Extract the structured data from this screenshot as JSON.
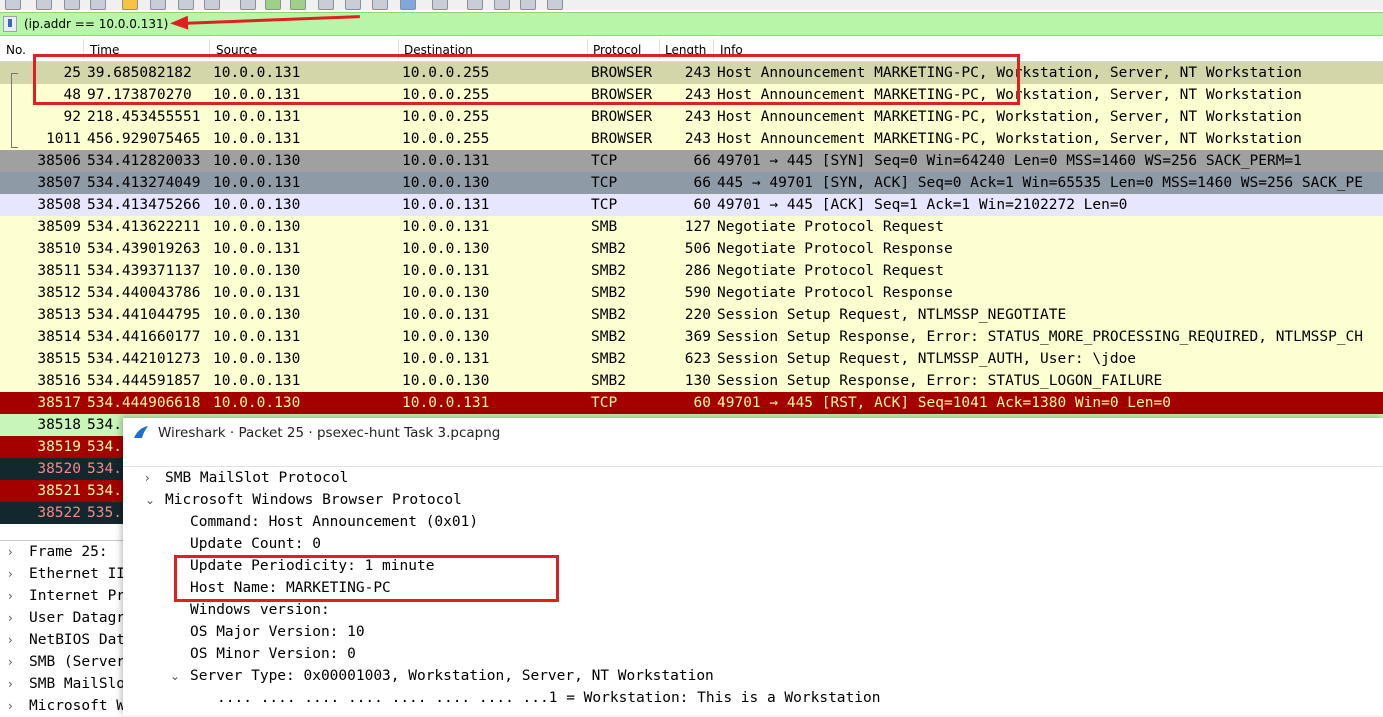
{
  "filter": {
    "expression": "(ip.addr == 10.0.0.131)"
  },
  "columns": [
    "No.",
    "Time",
    "Source",
    "Destination",
    "Protocol",
    "Length",
    "Info"
  ],
  "packets": [
    {
      "no": "25",
      "time": "39.685082182",
      "src": "10.0.0.131",
      "dst": "10.0.0.255",
      "proto": "BROWSER",
      "len": "243",
      "info": "Host Announcement MARKETING-PC, Workstation, Server, NT Workstation",
      "bg": "#d2d6a8",
      "fg": "#000000"
    },
    {
      "no": "48",
      "time": "97.173870270",
      "src": "10.0.0.131",
      "dst": "10.0.0.255",
      "proto": "BROWSER",
      "len": "243",
      "info": "Host Announcement MARKETING-PC, Workstation, Server, NT Workstation",
      "bg": "#feffd0",
      "fg": "#000000"
    },
    {
      "no": "92",
      "time": "218.453455551",
      "src": "10.0.0.131",
      "dst": "10.0.0.255",
      "proto": "BROWSER",
      "len": "243",
      "info": "Host Announcement MARKETING-PC, Workstation, Server, NT Workstation",
      "bg": "#feffd0",
      "fg": "#000000"
    },
    {
      "no": "1011",
      "time": "456.929075465",
      "src": "10.0.0.131",
      "dst": "10.0.0.255",
      "proto": "BROWSER",
      "len": "243",
      "info": "Host Announcement MARKETING-PC, Workstation, Server, NT Workstation",
      "bg": "#feffd0",
      "fg": "#000000"
    },
    {
      "no": "38506",
      "time": "534.412820033",
      "src": "10.0.0.130",
      "dst": "10.0.0.131",
      "proto": "TCP",
      "len": "66",
      "info": "49701 → 445 [SYN] Seq=0 Win=64240 Len=0 MSS=1460 WS=256 SACK_PERM=1",
      "bg": "#a0a0a0",
      "fg": "#000000"
    },
    {
      "no": "38507",
      "time": "534.413274049",
      "src": "10.0.0.131",
      "dst": "10.0.0.130",
      "proto": "TCP",
      "len": "66",
      "info": "445 → 49701 [SYN, ACK] Seq=0 Ack=1 Win=65535 Len=0 MSS=1460 WS=256 SACK_PE",
      "bg": "#8e9aa6",
      "fg": "#000000"
    },
    {
      "no": "38508",
      "time": "534.413475266",
      "src": "10.0.0.130",
      "dst": "10.0.0.131",
      "proto": "TCP",
      "len": "60",
      "info": "49701 → 445 [ACK] Seq=1 Ack=1 Win=2102272 Len=0",
      "bg": "#e7e6ff",
      "fg": "#000000"
    },
    {
      "no": "38509",
      "time": "534.413622211",
      "src": "10.0.0.130",
      "dst": "10.0.0.131",
      "proto": "SMB",
      "len": "127",
      "info": "Negotiate Protocol Request",
      "bg": "#feffd0",
      "fg": "#000000"
    },
    {
      "no": "38510",
      "time": "534.439019263",
      "src": "10.0.0.131",
      "dst": "10.0.0.130",
      "proto": "SMB2",
      "len": "506",
      "info": "Negotiate Protocol Response",
      "bg": "#feffd0",
      "fg": "#000000"
    },
    {
      "no": "38511",
      "time": "534.439371137",
      "src": "10.0.0.130",
      "dst": "10.0.0.131",
      "proto": "SMB2",
      "len": "286",
      "info": "Negotiate Protocol Request",
      "bg": "#feffd0",
      "fg": "#000000"
    },
    {
      "no": "38512",
      "time": "534.440043786",
      "src": "10.0.0.131",
      "dst": "10.0.0.130",
      "proto": "SMB2",
      "len": "590",
      "info": "Negotiate Protocol Response",
      "bg": "#feffd0",
      "fg": "#000000"
    },
    {
      "no": "38513",
      "time": "534.441044795",
      "src": "10.0.0.130",
      "dst": "10.0.0.131",
      "proto": "SMB2",
      "len": "220",
      "info": "Session Setup Request, NTLMSSP_NEGOTIATE",
      "bg": "#feffd0",
      "fg": "#000000"
    },
    {
      "no": "38514",
      "time": "534.441660177",
      "src": "10.0.0.131",
      "dst": "10.0.0.130",
      "proto": "SMB2",
      "len": "369",
      "info": "Session Setup Response, Error: STATUS_MORE_PROCESSING_REQUIRED, NTLMSSP_CH",
      "bg": "#feffd0",
      "fg": "#000000"
    },
    {
      "no": "38515",
      "time": "534.442101273",
      "src": "10.0.0.130",
      "dst": "10.0.0.131",
      "proto": "SMB2",
      "len": "623",
      "info": "Session Setup Request, NTLMSSP_AUTH, User: \\jdoe",
      "bg": "#feffd0",
      "fg": "#000000"
    },
    {
      "no": "38516",
      "time": "534.444591857",
      "src": "10.0.0.131",
      "dst": "10.0.0.130",
      "proto": "SMB2",
      "len": "130",
      "info": "Session Setup Response, Error: STATUS_LOGON_FAILURE",
      "bg": "#feffd0",
      "fg": "#000000"
    },
    {
      "no": "38517",
      "time": "534.444906618",
      "src": "10.0.0.130",
      "dst": "10.0.0.131",
      "proto": "TCP",
      "len": "60",
      "info": "49701 → 445 [RST, ACK] Seq=1041 Ack=1380 Win=0 Len=0",
      "bg": "#a40000",
      "fg": "#fffc9c"
    },
    {
      "no": "38518",
      "time": "534.",
      "src": "",
      "dst": "",
      "proto": "",
      "len": "",
      "info": "",
      "bg": "#c8f5b8",
      "fg": "#000000"
    },
    {
      "no": "38519",
      "time": "534.",
      "src": "",
      "dst": "",
      "proto": "",
      "len": "",
      "info": "",
      "bg": "#a40000",
      "fg": "#fffc9c"
    },
    {
      "no": "38520",
      "time": "534.",
      "src": "",
      "dst": "",
      "proto": "",
      "len": "",
      "info": "",
      "bg": "#12272e",
      "fg": "#f78787"
    },
    {
      "no": "38521",
      "time": "534.",
      "src": "",
      "dst": "",
      "proto": "",
      "len": "",
      "info": "",
      "bg": "#a40000",
      "fg": "#fffc9c"
    },
    {
      "no": "38522",
      "time": "535.",
      "src": "",
      "dst": "",
      "proto": "",
      "len": "",
      "info": "",
      "bg": "#12272e",
      "fg": "#f78787"
    }
  ],
  "details": [
    {
      "label": "Frame 25: ",
      "caret": "›"
    },
    {
      "label": "Ethernet II",
      "caret": "›"
    },
    {
      "label": "Internet Pr",
      "caret": "›"
    },
    {
      "label": "User Datagr",
      "caret": "›"
    },
    {
      "label": "NetBIOS Dat",
      "caret": "›"
    },
    {
      "label": "SMB (Server",
      "caret": "›"
    },
    {
      "label": "SMB MailSlo",
      "caret": "›"
    },
    {
      "label": "Microsoft W",
      "caret": "›"
    }
  ],
  "popup": {
    "title": "Wireshark · Packet 25 · psexec-hunt Task 3.pcapng",
    "tree": [
      {
        "text": "SMB MailSlot Protocol",
        "level": 0,
        "caret": "›"
      },
      {
        "text": "Microsoft Windows Browser Protocol",
        "level": 0,
        "caret": "⌄"
      },
      {
        "text": "Command: Host Announcement (0x01)",
        "level": 1,
        "caret": ""
      },
      {
        "text": "Update Count: 0",
        "level": 1,
        "caret": ""
      },
      {
        "text": "Update Periodicity: 1 minute",
        "level": 1,
        "caret": ""
      },
      {
        "text": "Host Name: MARKETING-PC",
        "level": 1,
        "caret": ""
      },
      {
        "text": "Windows version:",
        "level": 1,
        "caret": ""
      },
      {
        "text": "OS Major Version: 10",
        "level": 1,
        "caret": ""
      },
      {
        "text": "OS Minor Version: 0",
        "level": 1,
        "caret": ""
      },
      {
        "text": "Server Type: 0x00001003, Workstation, Server, NT Workstation",
        "level": 1,
        "caret": "⌄"
      },
      {
        "text": ".... .... .... .... .... .... .... ...1 = Workstation: This is a Workstation",
        "level": 2,
        "caret": ""
      }
    ]
  },
  "colors": {
    "highlight": "#e02020",
    "filter_bg": "#b8f5a8"
  }
}
